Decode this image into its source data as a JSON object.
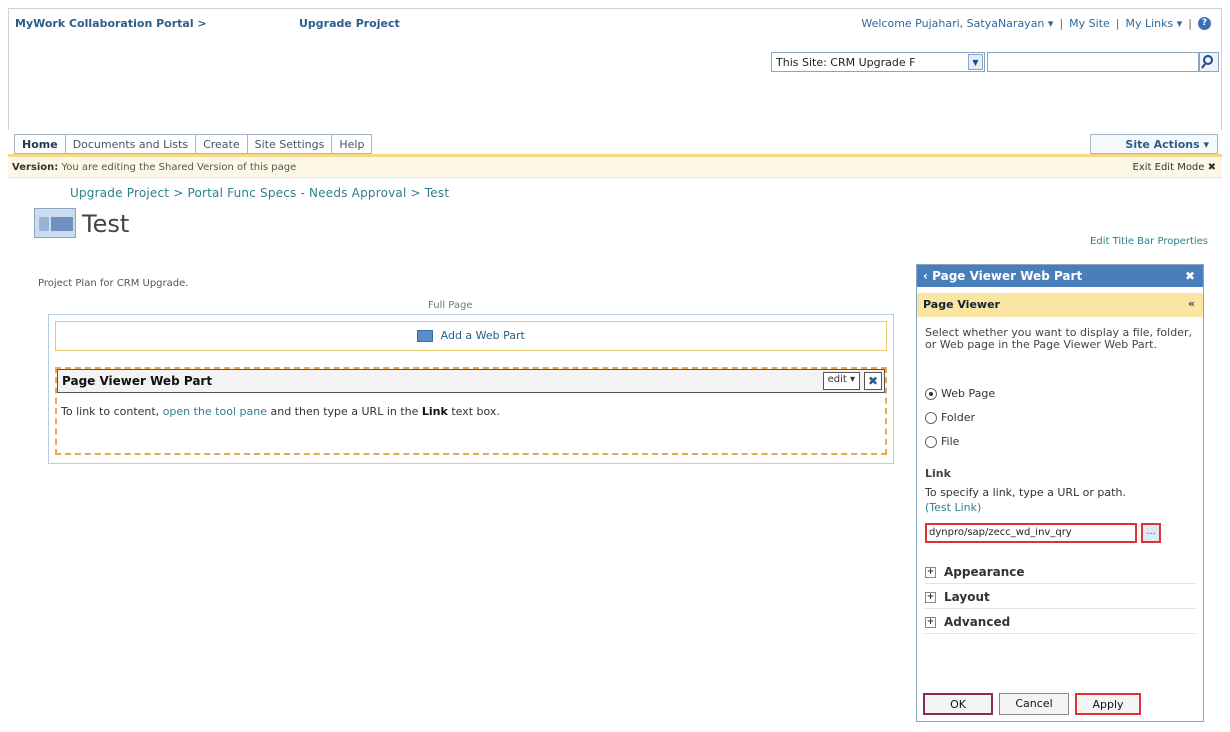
{
  "topbar": {
    "portal": "MyWork Collaboration Portal >",
    "site": "Upgrade Project",
    "welcome": "Welcome Pujahari, SatyaNarayan ▾",
    "mysite": "My Site",
    "mylinks": "My Links ▾",
    "sep": "|"
  },
  "search": {
    "scope": "This Site: CRM Upgrade F",
    "input_value": ""
  },
  "tabs": [
    "Home",
    "Documents and Lists",
    "Create",
    "Site Settings",
    "Help"
  ],
  "site_actions": "Site Actions ▾",
  "version": {
    "label": "Version:",
    "text": "You are editing the Shared Version of this page",
    "exit": "Exit Edit Mode ✖"
  },
  "breadcrumb": "Upgrade Project > Portal Func Specs - Needs Approval > Test",
  "page": {
    "title": "Test",
    "edit_title_props": "Edit Title Bar Properties",
    "description": "Project Plan for CRM Upgrade.",
    "zone_label": "Full Page",
    "add_web_part": "Add a Web Part"
  },
  "webpart": {
    "title": "Page Viewer Web Part",
    "edit": "edit ▾",
    "close": "✖",
    "body_pre": "To link to content,",
    "body_link": "open the tool pane",
    "body_mid": "and then type a URL in the",
    "body_bold": "Link",
    "body_post": "text box."
  },
  "toolpane": {
    "title": "‹ Page Viewer Web Part",
    "close": "✖",
    "section": "Page Viewer",
    "collapse": "«",
    "description": "Select whether you want to display a file, folder, or Web page in the Page Viewer Web Part.",
    "radios": [
      {
        "label": "Web Page",
        "checked": true
      },
      {
        "label": "Folder",
        "checked": false
      },
      {
        "label": "File",
        "checked": false
      }
    ],
    "link_label": "Link",
    "link_help": "To specify a link, type a URL or path.",
    "test_link": "(Test Link)",
    "link_value": "dynpro/sap/zecc_wd_inv_qry",
    "browse": "...",
    "expanders": [
      "Appearance",
      "Layout",
      "Advanced"
    ],
    "buttons": {
      "ok": "OK",
      "cancel": "Cancel",
      "apply": "Apply"
    }
  }
}
